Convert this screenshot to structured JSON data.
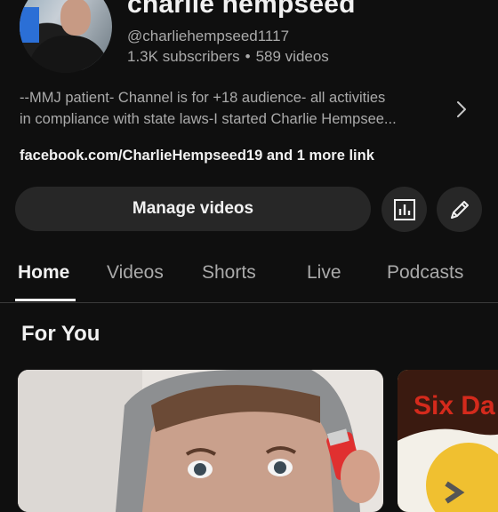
{
  "channel": {
    "name": "charlie hempseed",
    "handle": "@charliehempseed1117",
    "subscribers": "1.3K subscribers",
    "separator": "•",
    "videos": "589 videos",
    "description_line1": "--MMJ patient- Channel is for +18 audience- all activities",
    "description_line2": "in compliance with state laws-I started Charlie Hempsee...",
    "links": "facebook.com/CharlieHempseed19 and 1 more link"
  },
  "actions": {
    "manage_label": "Manage videos",
    "analytics_icon": "analytics-icon",
    "edit_icon": "pencil-icon"
  },
  "tabs": [
    {
      "label": "Home",
      "active": true
    },
    {
      "label": "Videos",
      "active": false
    },
    {
      "label": "Shorts",
      "active": false
    },
    {
      "label": "Live",
      "active": false
    },
    {
      "label": "Podcasts",
      "active": false
    }
  ],
  "section": {
    "title": "For You"
  },
  "thumbnails": {
    "side_title": "Six Da"
  },
  "colors": {
    "background": "#0f0f0f",
    "button": "#272727",
    "text_primary": "#f1f1f1",
    "text_secondary": "#aaaaaa"
  }
}
